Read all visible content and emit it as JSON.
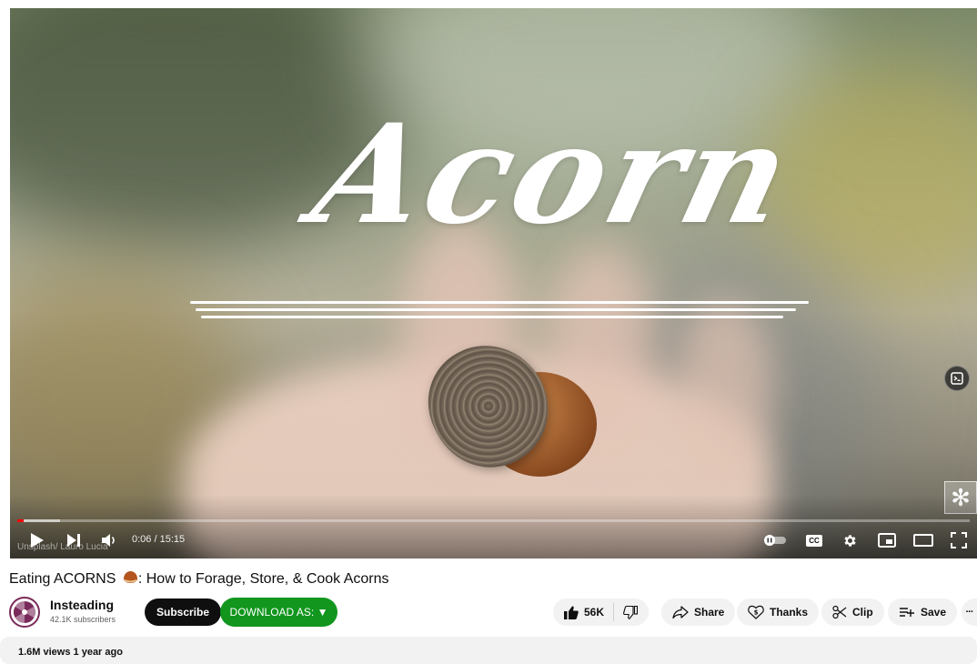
{
  "player": {
    "attribution": "Unsplash/ Lauro Lucia",
    "current_time": "0:06",
    "duration": "15:15",
    "time_display": "0:06 / 15:15",
    "progress_fraction": 0.007,
    "buffer_fraction": 0.045,
    "controls": {
      "play": "play-icon",
      "next": "next-icon",
      "volume": "volume-icon",
      "autoplay": "autoplay-toggle-icon",
      "captions": "CC",
      "settings": "gear-icon",
      "miniplayer": "miniplayer-icon",
      "theater": "theater-mode-icon",
      "fullscreen": "fullscreen-icon"
    }
  },
  "video": {
    "title_prefix": "Eating ACORNS",
    "title_suffix": ": How to Forage, Store, & Cook Acorns",
    "emoji_icon": "chestnut-icon"
  },
  "channel": {
    "name": "Insteading",
    "subscribers": "42.1K subscribers",
    "subscribe_label": "Subscribe",
    "download_label": "DOWNLOAD AS: ▼"
  },
  "actions": {
    "like_count": "56K",
    "share": "Share",
    "thanks": "Thanks",
    "clip": "Clip",
    "save": "Save",
    "more": "···"
  },
  "description": {
    "meta": "1.6M views  1 year ago"
  },
  "colors": {
    "progress": "#ff0000",
    "download_button": "#12961e",
    "subscribe_button": "#0f0f0f"
  }
}
